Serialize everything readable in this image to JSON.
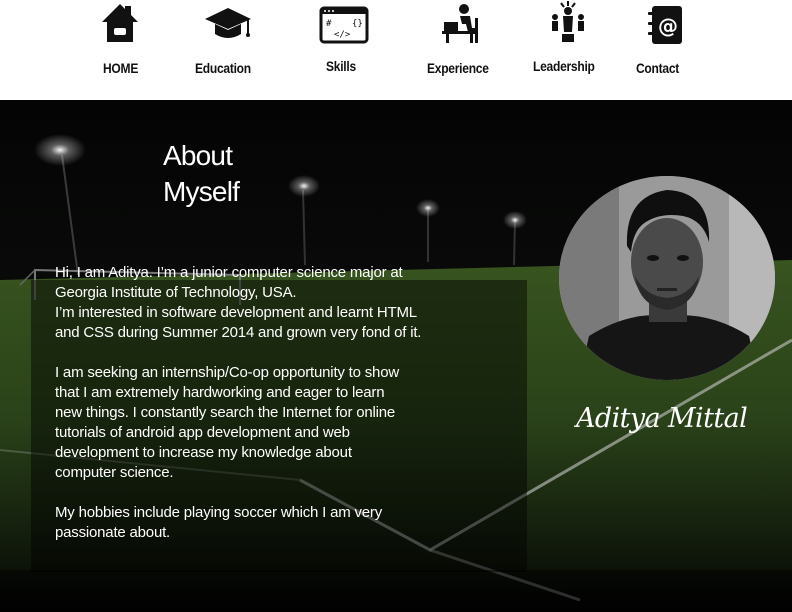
{
  "nav": {
    "items": [
      {
        "label": "HOME",
        "icon": "home-icon"
      },
      {
        "label": "Education",
        "icon": "graduation-cap-icon"
      },
      {
        "label": "Skills",
        "icon": "code-window-icon"
      },
      {
        "label": "Experience",
        "icon": "person-at-desk-icon"
      },
      {
        "label": "Leadership",
        "icon": "leader-group-icon"
      },
      {
        "label": "Contact",
        "icon": "address-book-at-icon"
      }
    ]
  },
  "about": {
    "title_line1": "About",
    "title_line2": "Myself",
    "p1_lines": [
      "Hi, I am Aditya. I’m a junior computer science major at",
      "Georgia Institute of Technology, USA.",
      "I’m interested in software development and learnt HTML",
      "and CSS during Summer 2014 and grown very fond of it."
    ],
    "p2_lines": [
      "I am seeking an internship/Co-op opportunity to show",
      "that I am extremely hardworking and eager to learn",
      "new things. I constantly search the Internet for online",
      "tutorials of android app development and web",
      "development to increase my knowledge about",
      "computer science."
    ],
    "p3_lines": [
      "My hobbies include playing soccer which I am very",
      "passionate about."
    ]
  },
  "profile": {
    "name": "Aditya Mittal",
    "photo_icon": "profile-photo"
  },
  "colors": {
    "nav_background": "#ffffff",
    "nav_text": "#111111",
    "hero_background": "#020302",
    "field_green": "#2f4a1c",
    "text": "#ffffff"
  }
}
